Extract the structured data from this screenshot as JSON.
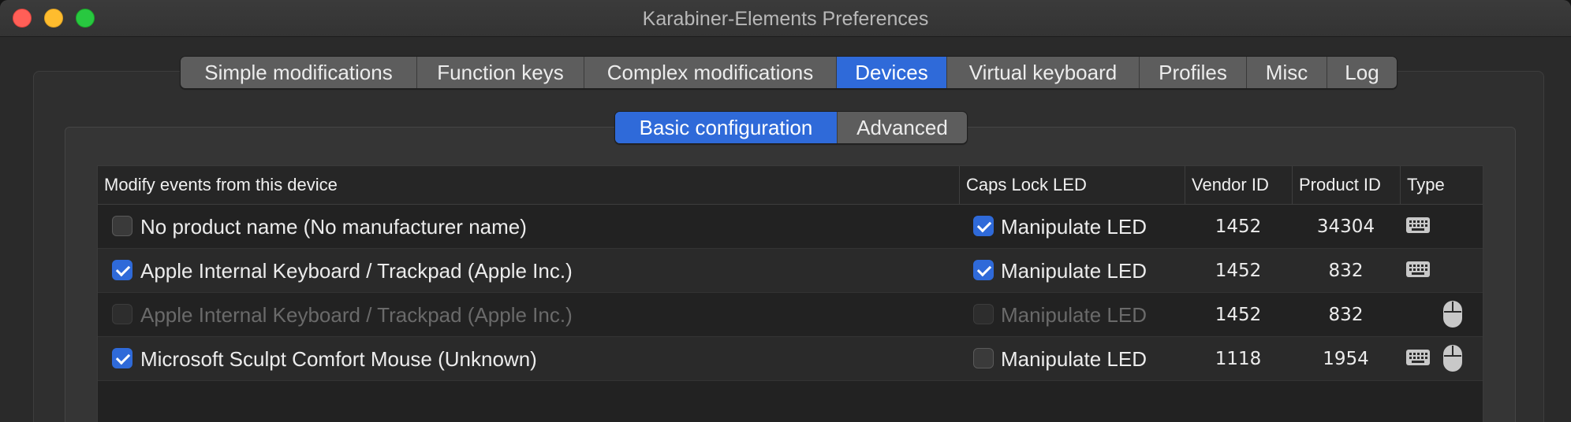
{
  "window": {
    "title": "Karabiner-Elements Preferences"
  },
  "main_tabs": [
    {
      "label": "Simple modifications",
      "active": false
    },
    {
      "label": "Function keys",
      "active": false
    },
    {
      "label": "Complex modifications",
      "active": false
    },
    {
      "label": "Devices",
      "active": true
    },
    {
      "label": "Virtual keyboard",
      "active": false
    },
    {
      "label": "Profiles",
      "active": false
    },
    {
      "label": "Misc",
      "active": false
    },
    {
      "label": "Log",
      "active": false
    }
  ],
  "sub_tabs": [
    {
      "label": "Basic configuration",
      "active": true
    },
    {
      "label": "Advanced",
      "active": false
    }
  ],
  "table": {
    "headers": {
      "device": "Modify events from this device",
      "caps_lock": "Caps Lock LED",
      "vendor_id": "Vendor ID",
      "product_id": "Product ID",
      "type": "Type"
    },
    "rows": [
      {
        "checked": false,
        "enabled": true,
        "name": "No product name (No manufacturer name)",
        "led_checked": true,
        "led_label": "Manipulate LED",
        "vendor_id": "1452",
        "product_id": "34304",
        "types": [
          "keyboard-icon"
        ]
      },
      {
        "checked": true,
        "enabled": true,
        "name": "Apple Internal Keyboard / Trackpad (Apple Inc.)",
        "led_checked": true,
        "led_label": "Manipulate LED",
        "vendor_id": "1452",
        "product_id": "832",
        "types": [
          "keyboard-icon"
        ]
      },
      {
        "checked": false,
        "enabled": false,
        "name": "Apple Internal Keyboard / Trackpad (Apple Inc.)",
        "led_checked": false,
        "led_label": "Manipulate LED",
        "vendor_id": "1452",
        "product_id": "832",
        "types": [
          "mouse-icon"
        ]
      },
      {
        "checked": true,
        "enabled": true,
        "name": "Microsoft Sculpt Comfort Mouse (Unknown)",
        "led_checked": false,
        "led_label": "Manipulate LED",
        "vendor_id": "1118",
        "product_id": "1954",
        "types": [
          "keyboard-icon",
          "mouse-icon"
        ]
      }
    ]
  },
  "colors": {
    "accent": "#2f6ad9",
    "background": "#2a2a2a"
  }
}
